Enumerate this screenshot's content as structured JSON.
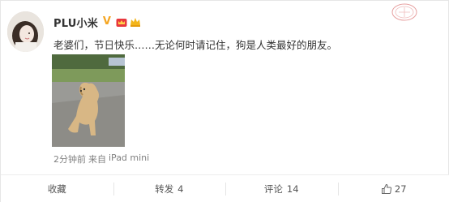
{
  "post": {
    "author": "PLU小米",
    "text": "老婆们，节日快乐……无论何时请记住，狗是人类最好的朋友。",
    "time": "2分钟前",
    "source_prefix": "来自",
    "source": "iPad mini"
  },
  "badges": {
    "verified": "V"
  },
  "actions": {
    "favorite_label": "收藏",
    "repost_label": "转发",
    "repost_count": "4",
    "comment_label": "评论",
    "comment_count": "14",
    "like_count": "27"
  },
  "colors": {
    "verified": "#f5a623",
    "vip": "#e8383d",
    "text": "#333333",
    "meta": "#808080"
  }
}
